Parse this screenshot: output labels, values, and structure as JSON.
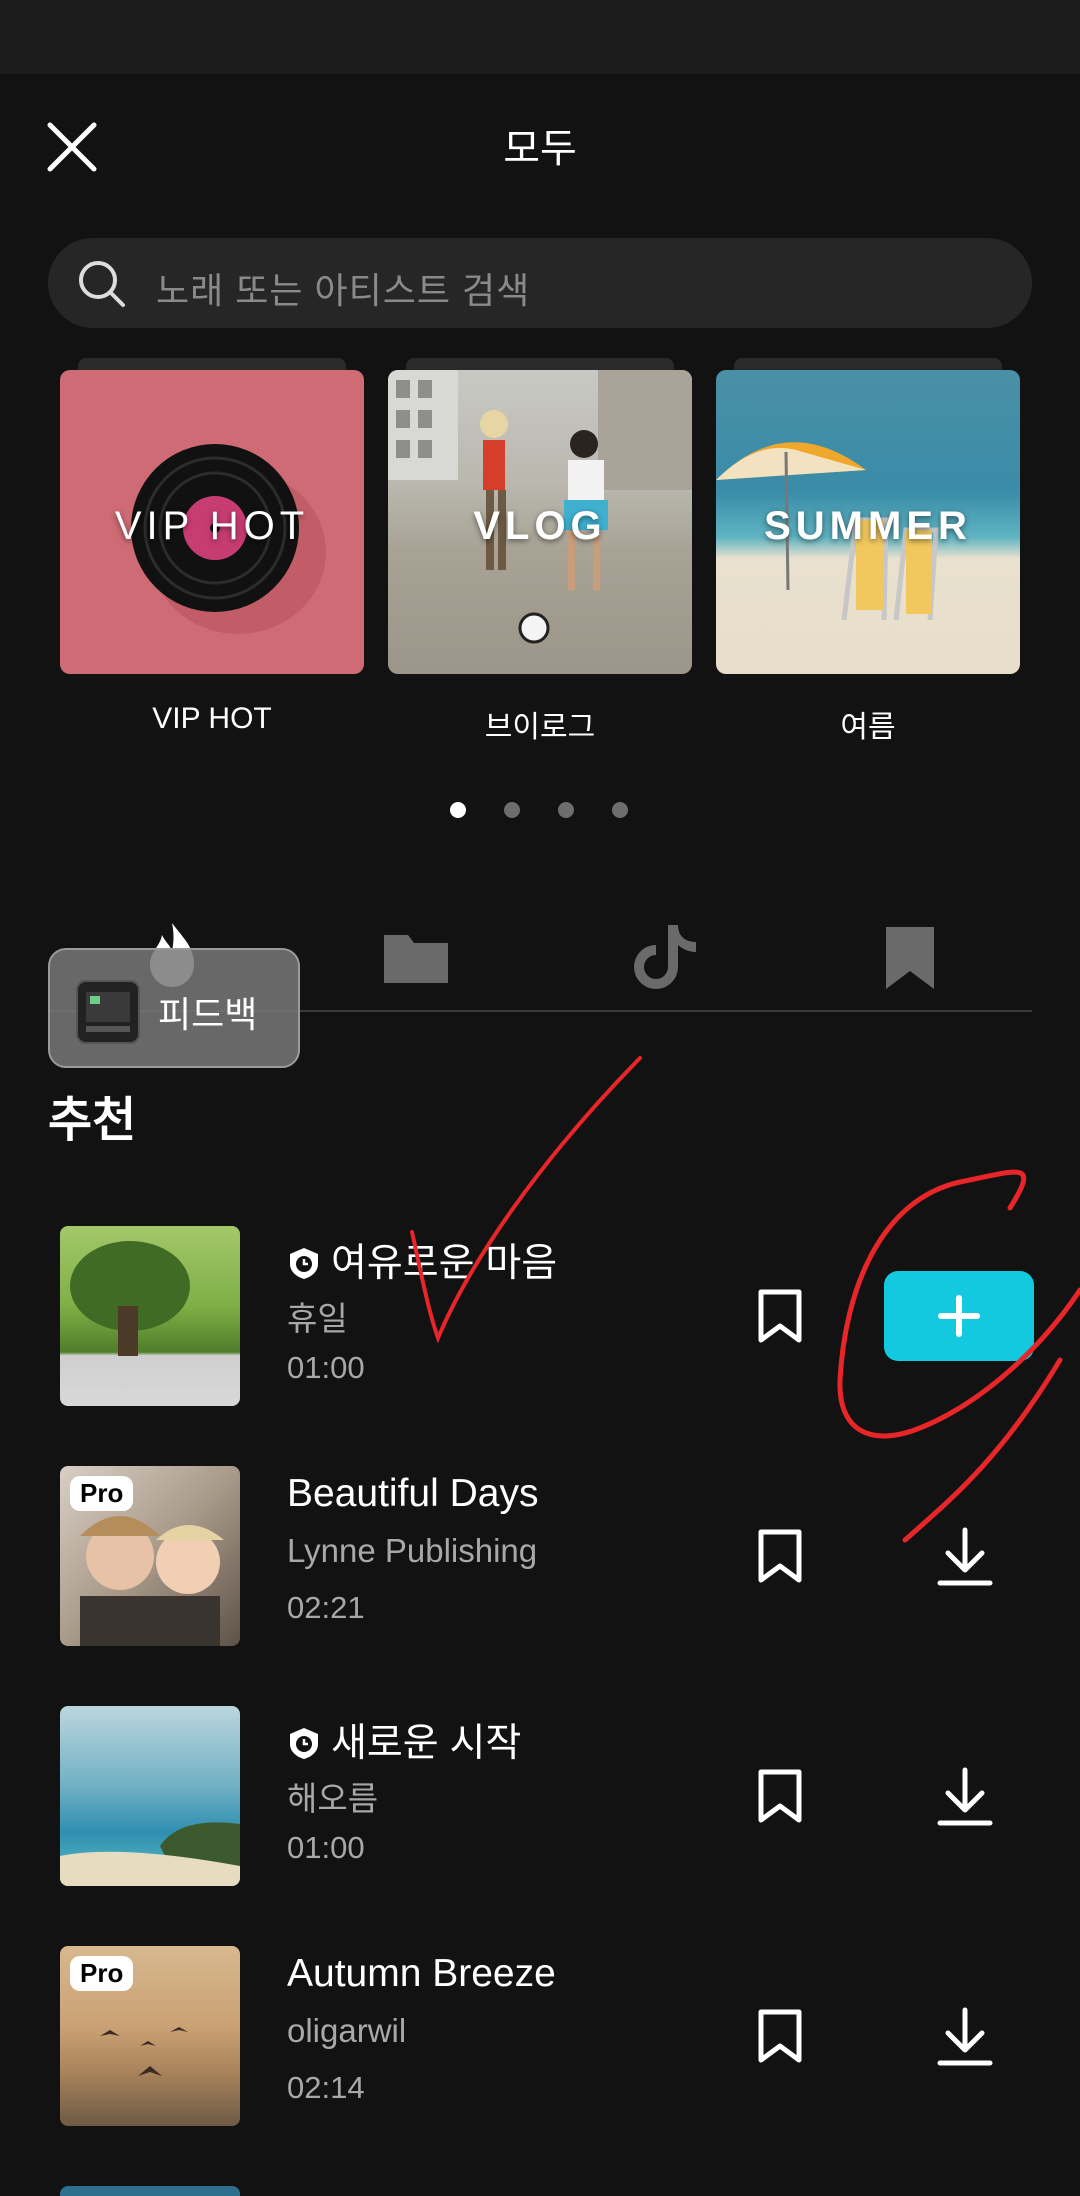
{
  "header": {
    "title": "모두"
  },
  "search": {
    "placeholder": "노래 또는 아티스트 검색"
  },
  "categories": [
    {
      "overlay": "VIP HOT",
      "caption": "VIP HOT"
    },
    {
      "overlay": "VLOG",
      "caption": "브이로그"
    },
    {
      "overlay": "SUMMER",
      "caption": "여름"
    }
  ],
  "pager": {
    "pages": 4,
    "active": 1
  },
  "tabs": [
    "flame-icon",
    "folder-icon",
    "tiktok-icon",
    "bookmark-icon"
  ],
  "feedback": {
    "label": "피드백"
  },
  "section": {
    "title": "추천"
  },
  "tracks": [
    {
      "name": "여유로운 마음",
      "artist": "휴일",
      "duration": "01:00",
      "badge": "clock",
      "action": "add"
    },
    {
      "name": "Beautiful Days",
      "artist": "Lynne Publishing",
      "duration": "02:21",
      "badge": "Pro",
      "action": "download"
    },
    {
      "name": "새로운 시작",
      "artist": "해오름",
      "duration": "01:00",
      "badge": "clock",
      "action": "download"
    },
    {
      "name": "Autumn Breeze",
      "artist": "oligarwil",
      "duration": "02:14",
      "badge": "Pro",
      "action": "download"
    }
  ],
  "colors": {
    "accent": "#12c9e0",
    "background": "#121212",
    "annotation": "#e8262a"
  }
}
